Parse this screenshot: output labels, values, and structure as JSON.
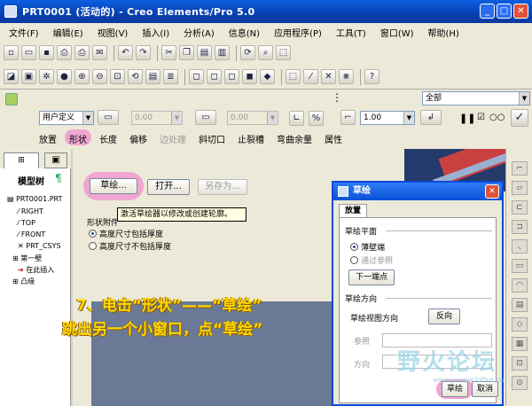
{
  "window": {
    "title": "PRT0001 (活动的) - Creo Elements/Pro 5.0"
  },
  "menu": [
    "文件(F)",
    "编辑(E)",
    "视图(V)",
    "插入(I)",
    "分析(A)",
    "信息(N)",
    "应用程序(P)",
    "工具(T)",
    "窗口(W)",
    "帮助(H)"
  ],
  "dashboard": {
    "select_user_defined": "用户定义",
    "value1": "0.00",
    "value2": "0.00",
    "value3": "1.00",
    "filter": "全部",
    "tabs": [
      {
        "label": "放置",
        "state": "normal"
      },
      {
        "label": "形状",
        "state": "active"
      },
      {
        "label": "长度",
        "state": "normal"
      },
      {
        "label": "偏移",
        "state": "normal"
      },
      {
        "label": "边处理",
        "state": "disabled"
      },
      {
        "label": "斜切口",
        "state": "normal"
      },
      {
        "label": "止裂槽",
        "state": "normal"
      },
      {
        "label": "弯曲余量",
        "state": "normal"
      },
      {
        "label": "属性",
        "state": "normal"
      }
    ]
  },
  "model_tree": {
    "title": "模型树",
    "items": [
      "PRT0001.PRT",
      "RIGHT",
      "TOP",
      "FRONT",
      "PRT_CSYS",
      "第一壁",
      "在此插入",
      "凸缘"
    ]
  },
  "shape_panel": {
    "sketch_button": "草绘...",
    "open_button": "打开...",
    "save_as_button": "另存为...",
    "tooltip": "激活草绘器以修改或创建轮廓。",
    "group_label": "形状附件",
    "options": [
      "高度尺寸包括厚度",
      "高度尺寸不包括厚度"
    ]
  },
  "annotation": {
    "line1": "7、电击“形状”——“草绘”",
    "line2": "跳出另一个小窗口，点“草绘”"
  },
  "sketch_dialog": {
    "title": "草绘",
    "tab": "放置",
    "plane_section": "草绘平面",
    "plane_options": [
      "薄壁端",
      "通过参照"
    ],
    "next_end_button": "下一端点",
    "orientation_section": "草绘方向",
    "view_direction_label": "草绘视图方向",
    "flip_button": "反向",
    "reference_label": "参照",
    "direction_label": "方向",
    "ok_button": "草绘",
    "cancel_button": "取消"
  },
  "watermark": {
    "text": "野火论坛",
    "url": "www.proewildfire.cn"
  }
}
